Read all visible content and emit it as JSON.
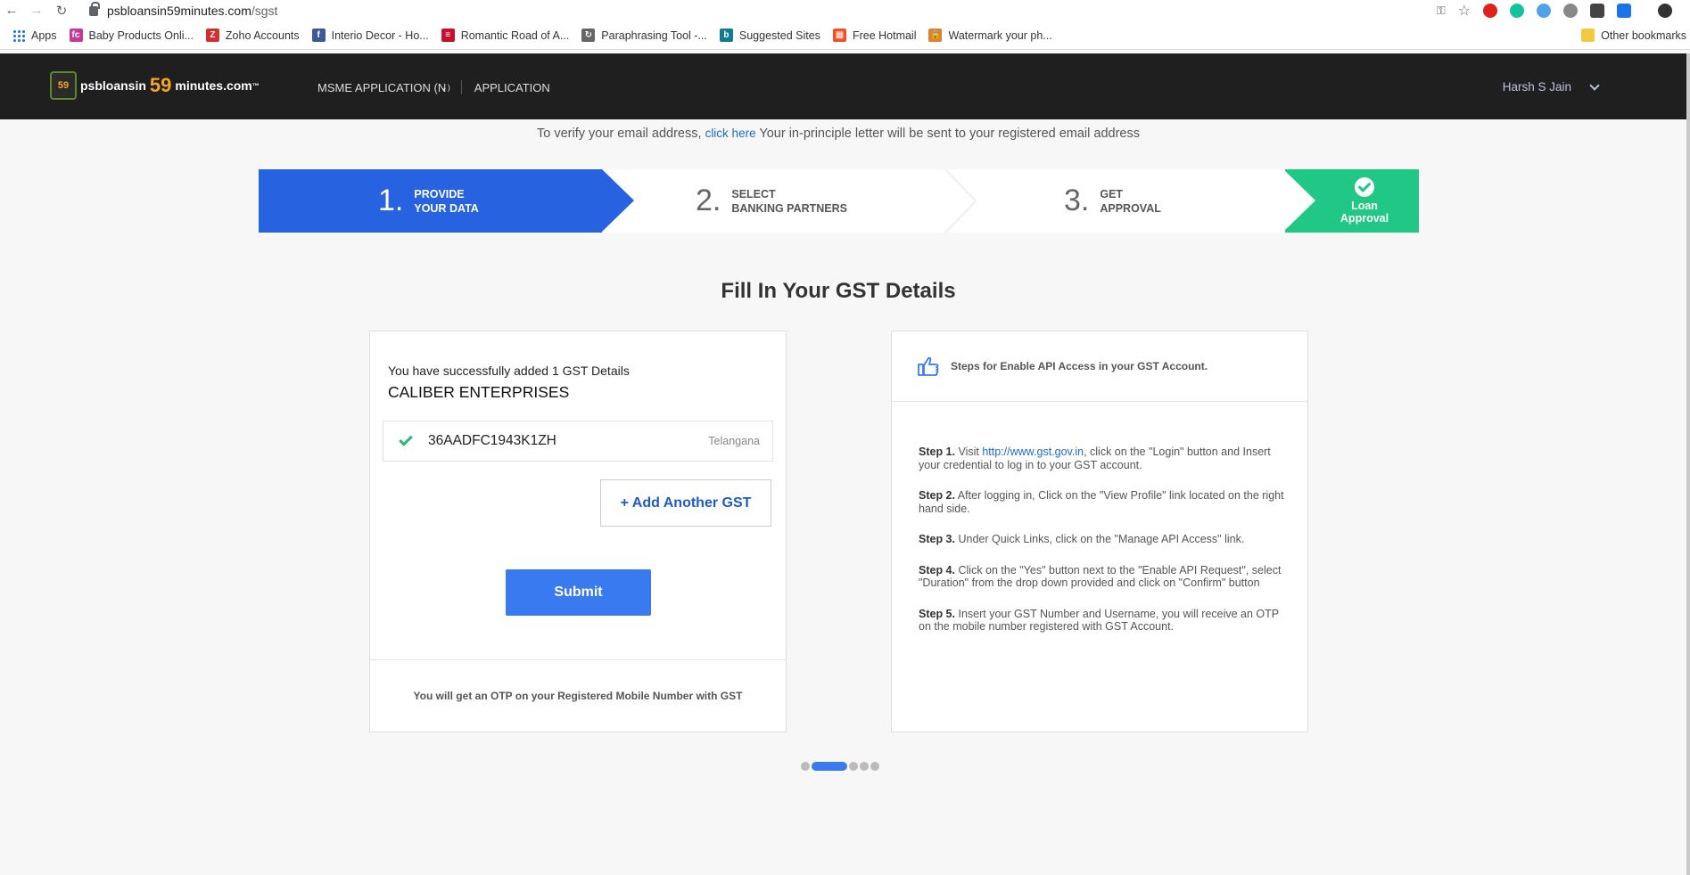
{
  "browser": {
    "url_host": "psbloansin59minutes.com",
    "url_path": "/sgst",
    "bookmarks": [
      {
        "label": "Apps",
        "icon": "apps-grid-icon"
      },
      {
        "label": "Baby Products Onli...",
        "icon": "babyproducts-favicon",
        "color": "#c23b9a",
        "glyph": "fc"
      },
      {
        "label": "Zoho Accounts",
        "icon": "zoho-favicon",
        "color": "#d32f2f",
        "glyph": "Z"
      },
      {
        "label": "Interio Decor - Ho...",
        "icon": "facebook-favicon",
        "color": "#3b5998",
        "glyph": "f"
      },
      {
        "label": "Romantic Road of A...",
        "icon": "austria-flag-favicon",
        "color": "#c8102e",
        "glyph": "≡"
      },
      {
        "label": "Paraphrasing Tool -...",
        "icon": "paraphrasing-favicon",
        "color": "#666666",
        "glyph": "↻"
      },
      {
        "label": "Suggested Sites",
        "icon": "bing-favicon",
        "color": "#0f7c90",
        "glyph": "b"
      },
      {
        "label": "Free Hotmail",
        "icon": "microsoft-favicon",
        "color": "#f25022",
        "glyph": "▦"
      },
      {
        "label": "Watermark your ph...",
        "icon": "lock-favicon",
        "color": "#e0802a",
        "glyph": "🔒"
      }
    ],
    "other_bookmarks": "Other bookmarks"
  },
  "header": {
    "logo_prefix": "psbloansin",
    "logo_number": "59",
    "logo_suffix": "minutes.com",
    "logo_tm": "™",
    "logo_badge": "59",
    "nav": [
      "MSME APPLICATION (N",
      "APPLICATION"
    ],
    "user_name": "Harsh S Jain"
  },
  "verify": {
    "prefix": "To verify your email address,",
    "link": "click here",
    "suffix": "Your in-principle letter will be sent to your registered email address"
  },
  "stepper": {
    "steps": [
      {
        "num": "1.",
        "line1": "PROVIDE",
        "line2": "YOUR DATA"
      },
      {
        "num": "2.",
        "line1": "SELECT",
        "line2": "BANKING PARTNERS"
      },
      {
        "num": "3.",
        "line1": "GET",
        "line2": "APPROVAL"
      }
    ],
    "final": {
      "line1": "Loan",
      "line2": "Approval"
    },
    "active_color": "#2763e0",
    "final_color": "#21c785"
  },
  "page_title": "Fill In Your GST Details",
  "gst_card": {
    "added_text": "You have successfully added 1 GST Details",
    "company": "CALIBER ENTERPRISES",
    "gst_number": "36AADFC1943K1ZH",
    "state": "Telangana",
    "add_button": "+ Add Another GST",
    "submit_button": "Submit",
    "otp_note": "You will get an OTP on your Registered Mobile Number with GST"
  },
  "help_card": {
    "title": "Steps for Enable API Access in your GST Account.",
    "steps": [
      {
        "label": "Step 1.",
        "pre": "Visit",
        "link": "http://www.gst.gov.in",
        "text": ", click on the \"Login\" button and Insert your credential to log in to your GST account."
      },
      {
        "label": "Step 2.",
        "text": "After logging in, Click on the \"View Profile\" link located on the right hand side."
      },
      {
        "label": "Step 3.",
        "text": "Under Quick Links, click on the \"Manage API Access\" link."
      },
      {
        "label": "Step 4.",
        "text": "Click on the \"Yes\" button next to the \"Enable API Request\", select \"Duration\" from the drop down provided and click on \"Confirm\" button"
      },
      {
        "label": "Step 5.",
        "text": "Insert your GST Number and Username, you will receive an OTP on the mobile number registered with GST Account."
      }
    ]
  },
  "pager": {
    "count": 5,
    "active": 1
  }
}
